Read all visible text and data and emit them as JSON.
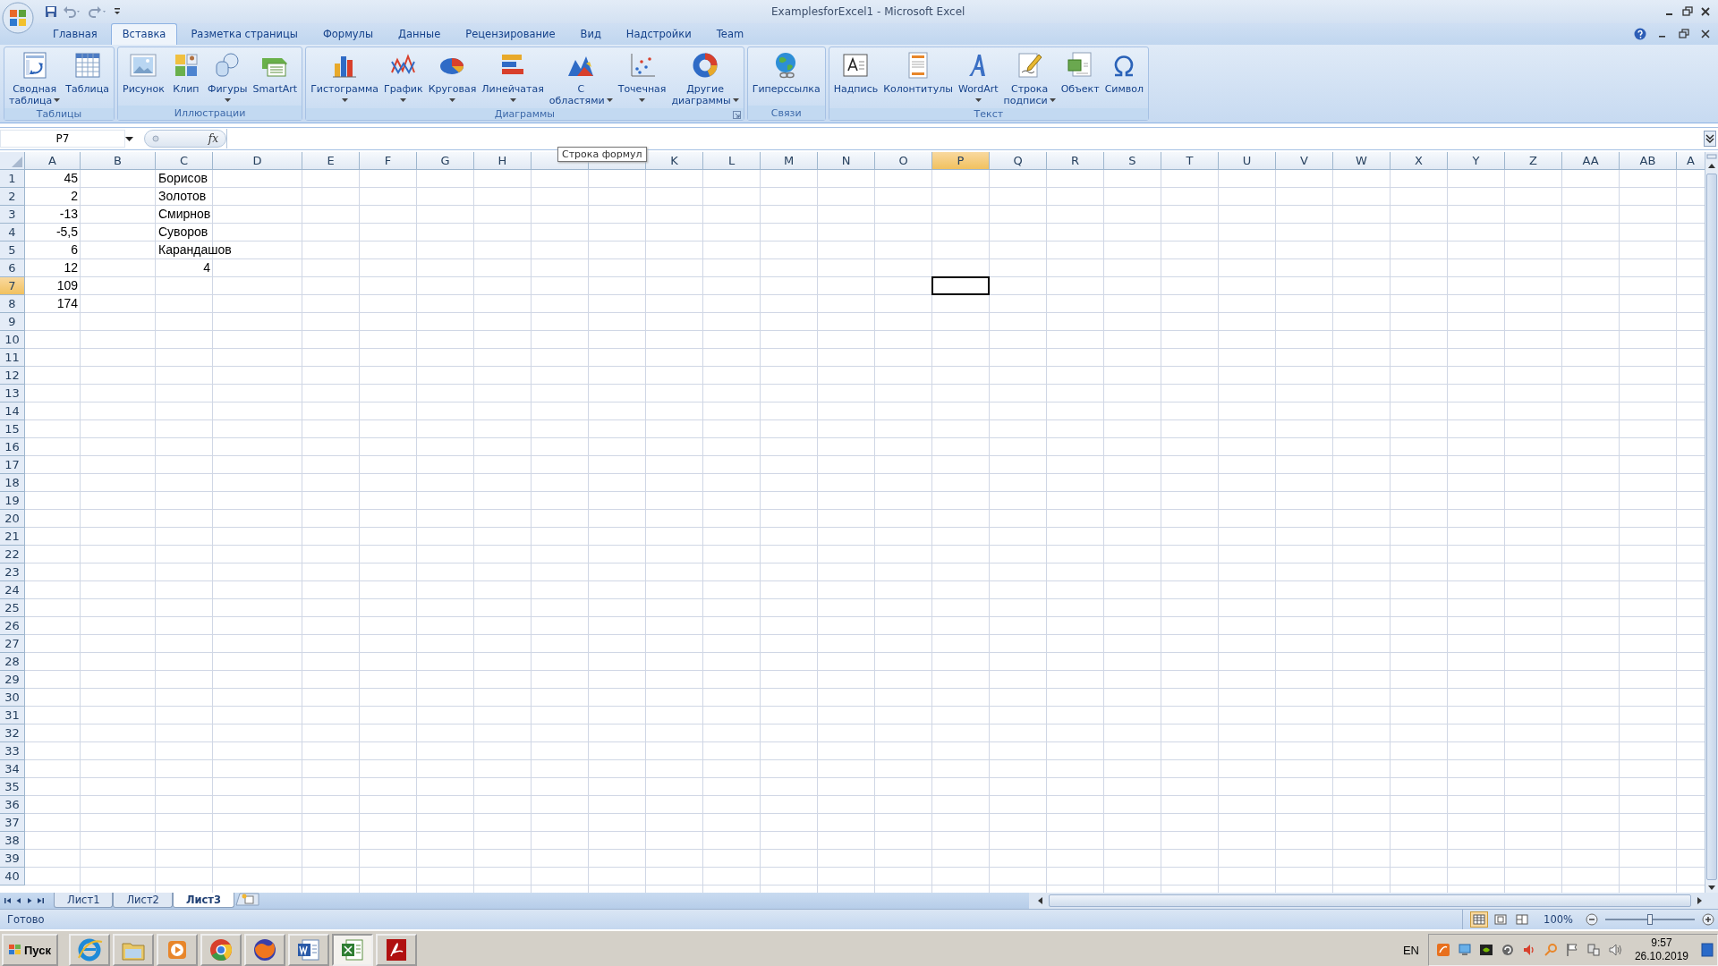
{
  "window": {
    "title": "ExamplesforExcel1 - Microsoft Excel"
  },
  "ribbon_tabs": [
    {
      "label": "Главная",
      "selected": false
    },
    {
      "label": "Вставка",
      "selected": true
    },
    {
      "label": "Разметка страницы",
      "selected": false
    },
    {
      "label": "Формулы",
      "selected": false
    },
    {
      "label": "Данные",
      "selected": false
    },
    {
      "label": "Рецензирование",
      "selected": false
    },
    {
      "label": "Вид",
      "selected": false
    },
    {
      "label": "Надстройки",
      "selected": false
    },
    {
      "label": "Team",
      "selected": false
    }
  ],
  "ribbon_groups": [
    {
      "label": "Таблицы",
      "launcher": false,
      "buttons": [
        {
          "label": "Сводная\nтаблица",
          "dropdown": true
        },
        {
          "label": "Таблица",
          "dropdown": false
        }
      ]
    },
    {
      "label": "Иллюстрации",
      "launcher": false,
      "buttons": [
        {
          "label": "Рисунок",
          "dropdown": false
        },
        {
          "label": "Клип",
          "dropdown": false
        },
        {
          "label": "Фигуры",
          "dropdown": true
        },
        {
          "label": "SmartArt",
          "dropdown": false
        }
      ]
    },
    {
      "label": "Диаграммы",
      "launcher": true,
      "buttons": [
        {
          "label": "Гистограмма",
          "dropdown": true
        },
        {
          "label": "График",
          "dropdown": true
        },
        {
          "label": "Круговая",
          "dropdown": true
        },
        {
          "label": "Линейчатая",
          "dropdown": true
        },
        {
          "label": "С\nобластями",
          "dropdown": true
        },
        {
          "label": "Точечная",
          "dropdown": true
        },
        {
          "label": "Другие\nдиаграммы",
          "dropdown": true
        }
      ]
    },
    {
      "label": "Связи",
      "launcher": false,
      "buttons": [
        {
          "label": "Гиперссылка",
          "dropdown": false
        }
      ]
    },
    {
      "label": "Текст",
      "launcher": false,
      "buttons": [
        {
          "label": "Надпись",
          "dropdown": false
        },
        {
          "label": "Колонтитулы",
          "dropdown": false
        },
        {
          "label": "WordArt",
          "dropdown": true
        },
        {
          "label": "Строка\nподписи",
          "dropdown": true
        },
        {
          "label": "Объект",
          "dropdown": false
        },
        {
          "label": "Символ",
          "dropdown": false
        }
      ]
    }
  ],
  "formula_bar": {
    "name_box": "P7",
    "fx": "fx",
    "tooltip": "Строка формул"
  },
  "columns": [
    {
      "label": "A",
      "selected": false
    },
    {
      "label": "B",
      "selected": false
    },
    {
      "label": "C",
      "selected": false
    },
    {
      "label": "D",
      "selected": false
    },
    {
      "label": "E",
      "selected": false
    },
    {
      "label": "F",
      "selected": false
    },
    {
      "label": "G",
      "selected": false
    },
    {
      "label": "H",
      "selected": false
    },
    {
      "selected": false
    },
    {
      "selected": false
    },
    {
      "label": "K",
      "selected": false
    },
    {
      "label": "L",
      "selected": false
    },
    {
      "label": "M",
      "selected": false
    },
    {
      "label": "N",
      "selected": false
    },
    {
      "label": "O",
      "selected": false
    },
    {
      "label": "P",
      "selected": true
    },
    {
      "label": "Q",
      "selected": false
    },
    {
      "label": "R",
      "selected": false
    },
    {
      "label": "S",
      "selected": false
    },
    {
      "label": "T",
      "selected": false
    },
    {
      "label": "U",
      "selected": false
    },
    {
      "label": "V",
      "selected": false
    },
    {
      "label": "W",
      "selected": false
    },
    {
      "label": "X",
      "selected": false
    },
    {
      "label": "Y",
      "selected": false
    },
    {
      "label": "Z",
      "selected": false
    },
    {
      "label": "AA",
      "selected": false
    },
    {
      "label": "AB",
      "selected": false
    },
    {
      "label": "A",
      "selected": false
    }
  ],
  "rows": [
    {
      "label": "1",
      "selected": false,
      "cells": [
        {
          "kind": "number",
          "text": "45"
        },
        {
          "kind": "blank"
        },
        {
          "kind": "text",
          "text": "Борисов"
        }
      ]
    },
    {
      "label": "2",
      "selected": false,
      "cells": [
        {
          "kind": "number",
          "text": "2"
        },
        {
          "kind": "blank"
        },
        {
          "kind": "text",
          "text": "Золотов"
        }
      ]
    },
    {
      "label": "3",
      "selected": false,
      "cells": [
        {
          "kind": "number",
          "text": "-13"
        },
        {
          "kind": "blank"
        },
        {
          "kind": "text",
          "text": "Смирнов"
        }
      ]
    },
    {
      "label": "4",
      "selected": false,
      "cells": [
        {
          "kind": "number",
          "text": "-5,5"
        },
        {
          "kind": "blank"
        },
        {
          "kind": "text",
          "text": "Суворов"
        }
      ]
    },
    {
      "label": "5",
      "selected": false,
      "cells": [
        {
          "kind": "number",
          "text": "6"
        },
        {
          "kind": "blank"
        },
        {
          "kind": "text",
          "text": "Карандашов"
        }
      ]
    },
    {
      "label": "6",
      "selected": false,
      "cells": [
        {
          "kind": "number",
          "text": "12"
        },
        {
          "kind": "blank"
        },
        {
          "kind": "number",
          "text": "4"
        }
      ]
    },
    {
      "label": "7",
      "selected": true,
      "cells": [
        {
          "kind": "number",
          "text": "109"
        }
      ]
    },
    {
      "label": "8",
      "selected": false,
      "cells": [
        {
          "kind": "number",
          "text": "174"
        }
      ]
    },
    {
      "label": "9",
      "selected": false
    },
    {
      "label": "10",
      "selected": false
    },
    {
      "label": "11",
      "selected": false
    },
    {
      "label": "12",
      "selected": false
    },
    {
      "label": "13",
      "selected": false
    },
    {
      "label": "14",
      "selected": false
    },
    {
      "label": "15",
      "selected": false
    },
    {
      "label": "16",
      "selected": false
    },
    {
      "label": "17",
      "selected": false
    },
    {
      "label": "18",
      "selected": false
    },
    {
      "label": "19",
      "selected": false
    },
    {
      "label": "20",
      "selected": false
    },
    {
      "label": "21",
      "selected": false
    },
    {
      "label": "22",
      "selected": false
    },
    {
      "label": "23",
      "selected": false
    },
    {
      "label": "24",
      "selected": false
    },
    {
      "label": "25",
      "selected": false
    },
    {
      "label": "26",
      "selected": false
    },
    {
      "label": "27",
      "selected": false
    },
    {
      "label": "28",
      "selected": false
    },
    {
      "label": "29",
      "selected": false
    },
    {
      "label": "30",
      "selected": false
    },
    {
      "label": "31",
      "selected": false
    },
    {
      "label": "32",
      "selected": false
    },
    {
      "label": "33",
      "selected": false
    },
    {
      "label": "34",
      "selected": false
    },
    {
      "label": "35",
      "selected": false
    },
    {
      "label": "36",
      "selected": false
    },
    {
      "label": "37",
      "selected": false
    },
    {
      "label": "38",
      "selected": false
    },
    {
      "label": "39",
      "selected": false
    },
    {
      "label": "40",
      "selected": false
    }
  ],
  "sheet_tabs": [
    {
      "label": "Лист1",
      "selected": false
    },
    {
      "label": "Лист2",
      "selected": false
    },
    {
      "label": "Лист3",
      "selected": true
    }
  ],
  "status_bar": {
    "text": "Готово",
    "views": [
      {
        "selected": true
      },
      {
        "selected": false
      },
      {
        "selected": false
      }
    ],
    "zoom": "100%",
    "zoom_slider": {
      "level": 0.5
    }
  },
  "taskbar": {
    "start": "Пуск",
    "apps": [
      {
        "active": false
      },
      {
        "active": false
      },
      {
        "active": false
      },
      {
        "active": false
      },
      {
        "active": false
      },
      {
        "active": false
      },
      {
        "active": true
      },
      {
        "active": false
      }
    ],
    "language": "EN",
    "time": "9:57",
    "date": "26.10.2019"
  }
}
